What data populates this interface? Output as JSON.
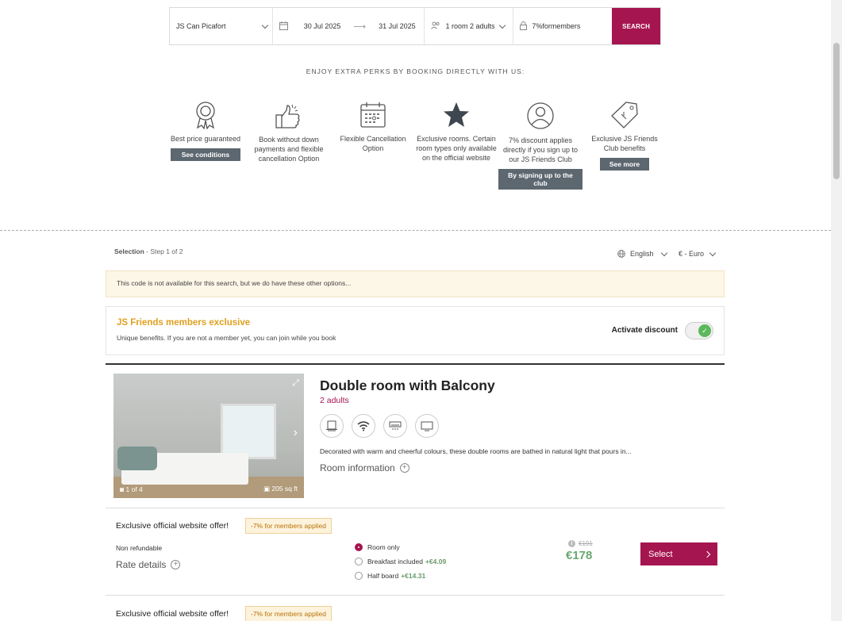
{
  "search": {
    "hotel": "JS Can Picafort",
    "checkin": "30 Jul 2025",
    "checkout": "31 Jul 2025",
    "guests": "1 room 2 adults",
    "promo_code": "7%formembers",
    "search_label": "SEARCH"
  },
  "perks": {
    "title": "ENJOY EXTRA PERKS BY BOOKING DIRECTLY WITH US:",
    "items": [
      {
        "text": "Best price guaranteed",
        "button": "See conditions",
        "icon": "award-ribbon-icon"
      },
      {
        "text": "Book without down payments and flexible cancellation Option",
        "icon": "thumbs-up-icon"
      },
      {
        "text": "Flexible Cancellation Option",
        "icon": "calendar-icon"
      },
      {
        "text": "Exclusive rooms. Certain room types only available on the official website",
        "icon": "star-icon"
      },
      {
        "text": "7% discount applies directly if you sign up to our JS Friends Club",
        "button": "By signing up to the club",
        "icon": "user-icon"
      },
      {
        "text": "Exclusive JS Friends Club benefits",
        "button": "See more",
        "icon": "tag-icon"
      }
    ]
  },
  "selection": {
    "step_label": "Selection",
    "step_text": " - Step 1 of 2",
    "language": "English",
    "currency": "€ - Euro"
  },
  "notice": "This code is not available for this search, but we do have these other options...",
  "members": {
    "title": "JS Friends members exclusive",
    "subtitle": "Unique benefits. If you are not a member yet, you can join while you book",
    "activate_label": "Activate discount",
    "activated": true
  },
  "room": {
    "title": "Double room with Balcony",
    "occupancy": "2 adults",
    "description": "Decorated with warm and cheerful colours, these double rooms are bathed in natural light that pours in...",
    "info_label": "Room information",
    "photo_count": "1 of 4",
    "size": "205 sq ft",
    "amenities": [
      "minibar-icon",
      "wifi-icon",
      "air-conditioning-icon",
      "tv-icon"
    ]
  },
  "rates": [
    {
      "offer": "Exclusive official website offer!",
      "badge": "-7% for members applied",
      "policy": "Non refundable",
      "details_label": "Rate details",
      "options": [
        {
          "label": "Room only",
          "extra": "",
          "selected": true
        },
        {
          "label": "Breakfast included",
          "extra": "+€4.09",
          "selected": false
        },
        {
          "label": "Half board",
          "extra": "+€14.31",
          "selected": false
        }
      ],
      "old_price": "€191",
      "price": "€178",
      "select_label": "Select"
    },
    {
      "offer": "Exclusive official website offer!",
      "badge": "-7% for members applied"
    }
  ],
  "colors": {
    "brand": "#a5154f",
    "price_green": "#6aa86f",
    "members_gold": "#e0a020"
  }
}
